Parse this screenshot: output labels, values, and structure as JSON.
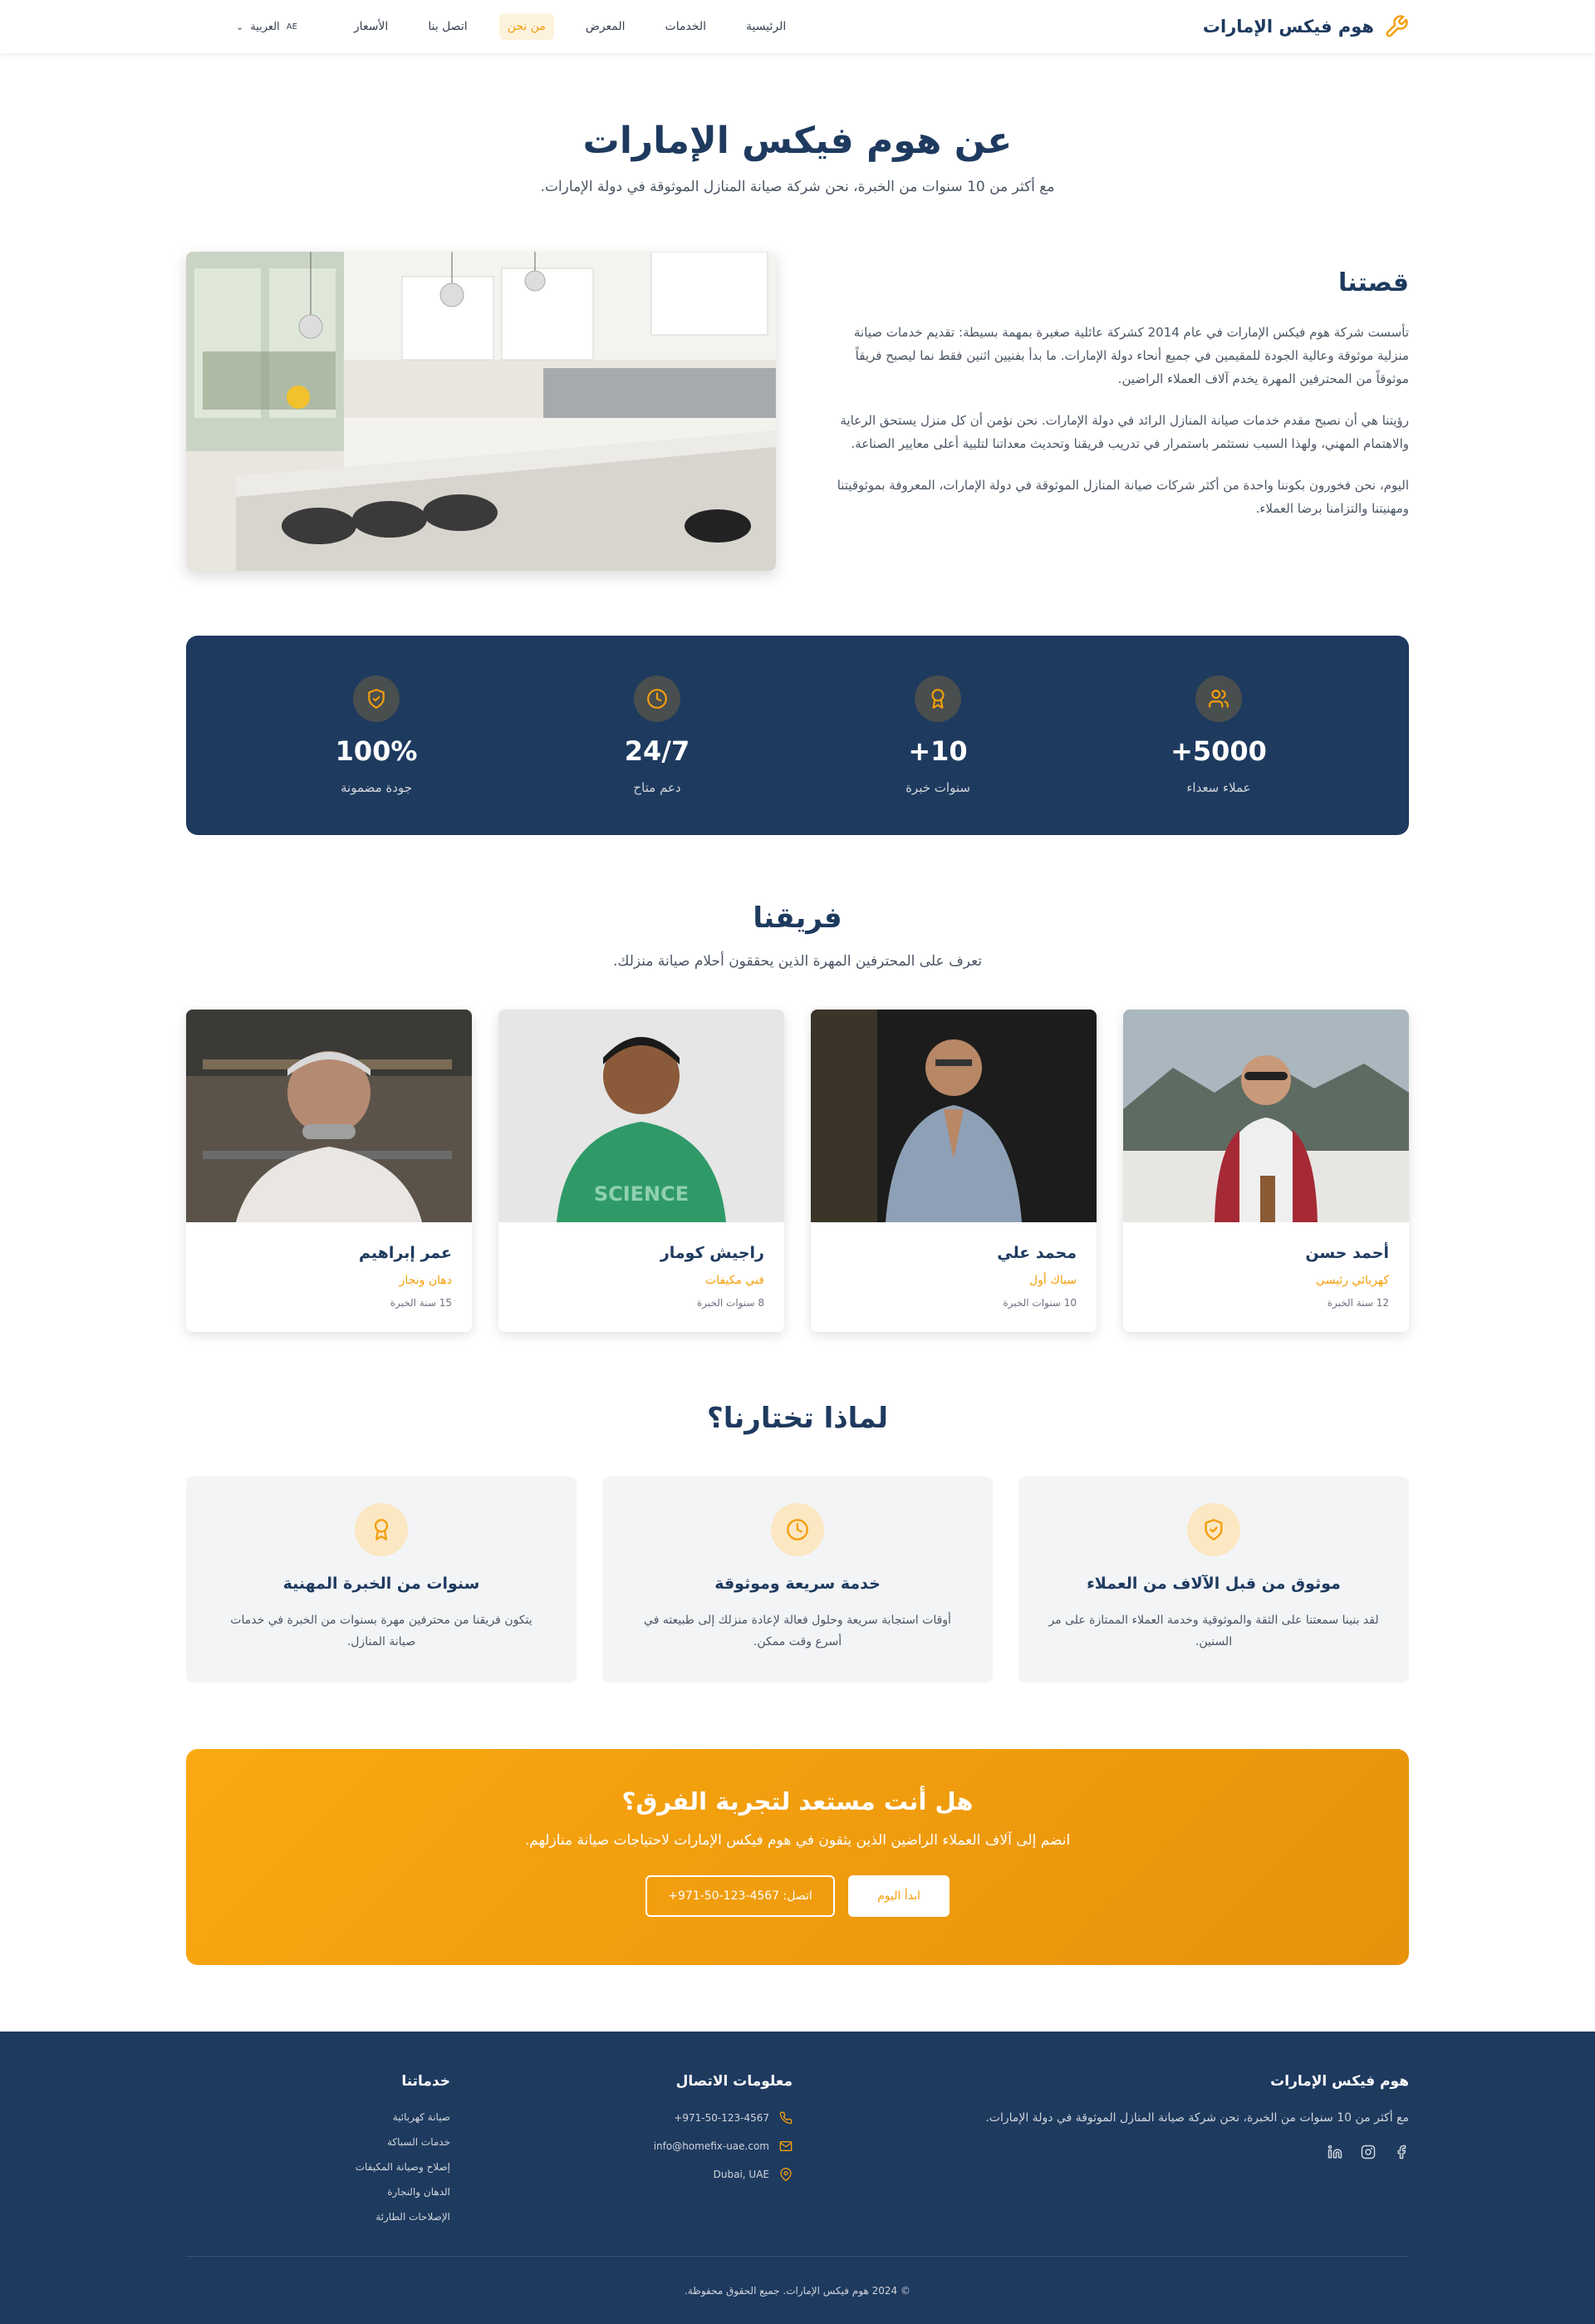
{
  "nav": {
    "brand": "هوم فيكس الإمارات",
    "links": [
      "الرئيسية",
      "الخدمات",
      "المعرض",
      "من نحن",
      "اتصل بنا",
      "الأسعار"
    ],
    "active": "من نحن",
    "lang_code": "AE",
    "lang_label": "العربية"
  },
  "hero": {
    "title": "عن هوم فيكس الإمارات",
    "subtitle": "مع أكثر من 10 سنوات من الخبرة، نحن شركة صيانة المنازل الموثوقة في دولة الإمارات."
  },
  "story": {
    "title": "قصتنا",
    "paragraphs": [
      "تأسست شركة هوم فيكس الإمارات في عام 2014 كشركة عائلية صغيرة بمهمة بسيطة: تقديم خدمات صيانة منزلية موثوقة وعالية الجودة للمقيمين في جميع أنحاء دولة الإمارات. ما بدأ بفنيين اثنين فقط نما ليصبح فريقاً موثوقاً من المحترفين المهرة يخدم آلاف العملاء الراضين.",
      "رؤيتنا هي أن نصبح مقدم خدمات صيانة المنازل الرائد في دولة الإمارات. نحن نؤمن أن كل منزل يستحق الرعاية والاهتمام المهني، ولهذا السبب نستثمر باستمرار في تدريب فريقنا وتحديث معداتنا لتلبية أعلى معايير الصناعة.",
      "اليوم، نحن فخورون بكوننا واحدة من أكثر شركات صيانة المنازل الموثوقة في دولة الإمارات، المعروفة بموثوقيتنا ومهنيتنا والتزامنا برضا العملاء."
    ]
  },
  "stats": [
    {
      "value": "+5000",
      "label": "عملاء سعداء",
      "icon": "users-icon"
    },
    {
      "value": "+10",
      "label": "سنوات خبرة",
      "icon": "award-icon"
    },
    {
      "value": "24/7",
      "label": "دعم متاح",
      "icon": "clock-icon"
    },
    {
      "value": "100%",
      "label": "جودة مضمونة",
      "icon": "shield-icon"
    }
  ],
  "team": {
    "title": "فريقنا",
    "subtitle": "تعرف على المحترفين المهرة الذين يحققون أحلام صيانة منزلك.",
    "members": [
      {
        "name": "أحمد حسن",
        "role": "كهربائي رئيسي",
        "exp": "12 سنة الخبرة"
      },
      {
        "name": "محمد علي",
        "role": "سباك أول",
        "exp": "10 سنوات الخبرة"
      },
      {
        "name": "راجيش كومار",
        "role": "فني مكيفات",
        "exp": "8 سنوات الخبرة"
      },
      {
        "name": "عمر إبراهيم",
        "role": "دهان ونجار",
        "exp": "15 سنة الخبرة"
      }
    ]
  },
  "why": {
    "title": "لماذا تختارنا؟",
    "cards": [
      {
        "title": "موثوق من قبل الآلاف من العملاء",
        "desc": "لقد بنينا سمعتنا على الثقة والموثوقية وخدمة العملاء الممتازة على مر السنين.",
        "icon": "shield-icon"
      },
      {
        "title": "خدمة سريعة وموثوقة",
        "desc": "أوقات استجابة سريعة وحلول فعالة لإعادة منزلك إلى طبيعته في أسرع وقت ممكن.",
        "icon": "clock-icon"
      },
      {
        "title": "سنوات من الخبرة المهنية",
        "desc": "يتكون فريقنا من محترفين مهرة بسنوات من الخبرة في خدمات صيانة المنازل.",
        "icon": "award-icon"
      }
    ]
  },
  "cta": {
    "title": "هل أنت مستعد لتجربة الفرق؟",
    "subtitle": "انضم إلى آلاف العملاء الراضين الذين يثقون في هوم فيكس الإمارات لاحتياجات صيانة منازلهم.",
    "primary": "ابدأ اليوم",
    "secondary": "اتصل: 4567-123-50-971+"
  },
  "footer": {
    "about_title": "هوم فيكس الإمارات",
    "about_text": "مع أكثر من 10 سنوات من الخبرة، نحن شركة صيانة المنازل الموثوقة في دولة الإمارات.",
    "contact_title": "معلومات الاتصال",
    "phone": "+971-50-123-4567",
    "email": "info@homefix-uae.com",
    "location": "Dubai, UAE",
    "services_title": "خدماتنا",
    "services": [
      "صيانة كهربائية",
      "خدمات السباكة",
      "إصلاح وصيانة المكيفات",
      "الدهان والنجارة",
      "الإصلاحات الطارئة"
    ],
    "copyright": "© 2024 هوم فيكس الإمارات. جميع الحقوق محفوظة."
  },
  "colors": {
    "navy": "#1e3a5f",
    "accent": "#f59e0b",
    "light_bg": "#f3f4f6"
  }
}
